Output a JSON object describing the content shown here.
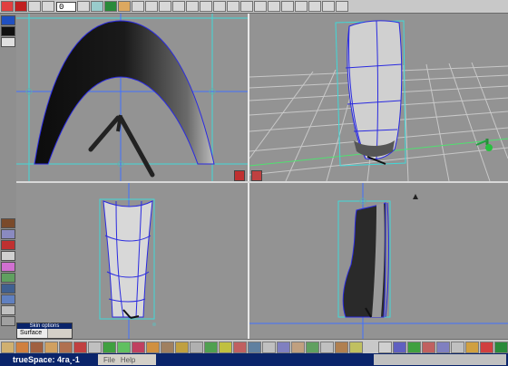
{
  "app": {
    "window_title": "trueSpace: 4га¸-1"
  },
  "toolbar": {
    "frame_value": "0"
  },
  "skin_panel": {
    "title": "Skin options",
    "tab": "Surface"
  },
  "menu": {
    "file": "File",
    "help": "Help"
  },
  "colors": {
    "viewport_bg": "#939393",
    "grid": "#c8c8c8",
    "wire": "#2a2ae0",
    "bbox": "#40d8d8",
    "accent": "#0a246a"
  },
  "icons": [
    "record-icon",
    "play-icon",
    "stop-icon",
    "object-tool-icon",
    "move-icon",
    "rotate-icon",
    "scale-icon",
    "camera-icon",
    "paint-icon",
    "light-icon",
    "render-icon"
  ]
}
